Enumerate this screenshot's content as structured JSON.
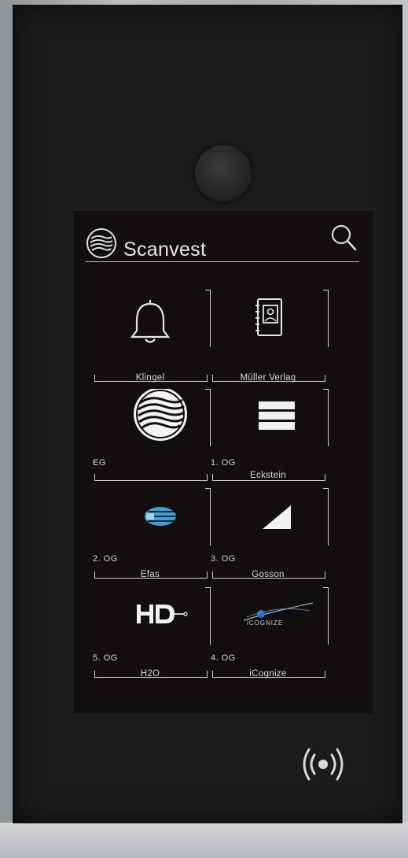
{
  "brand": {
    "name": "Scanvest"
  },
  "search": {
    "icon": "search-icon"
  },
  "tiles": [
    {
      "floor": "",
      "name": "Klingel",
      "icon": "bell-icon"
    },
    {
      "floor": "",
      "name": "Müller Verlag",
      "icon": "contact-book-icon"
    },
    {
      "floor": "EG",
      "name": "",
      "icon": "scanvest-logo-icon"
    },
    {
      "floor": "1. OG",
      "name": "Eckstein",
      "icon": "stacked-bars-logo-icon"
    },
    {
      "floor": "2. OG",
      "name": "Efas",
      "icon": "efas-logo-icon"
    },
    {
      "floor": "3. OG",
      "name": "Gosson",
      "icon": "gosson-triangle-logo-icon"
    },
    {
      "floor": "5. OG",
      "name": "H2O",
      "icon": "h2o-logo-icon"
    },
    {
      "floor": "4. OG",
      "name": "iCognize",
      "icon": "icognize-logo-icon"
    }
  ],
  "colors": {
    "panel": "#1c1b1b",
    "screen": "#120e0d",
    "text": "#d8d8d8",
    "accent_blue": "#3aa0e0"
  }
}
